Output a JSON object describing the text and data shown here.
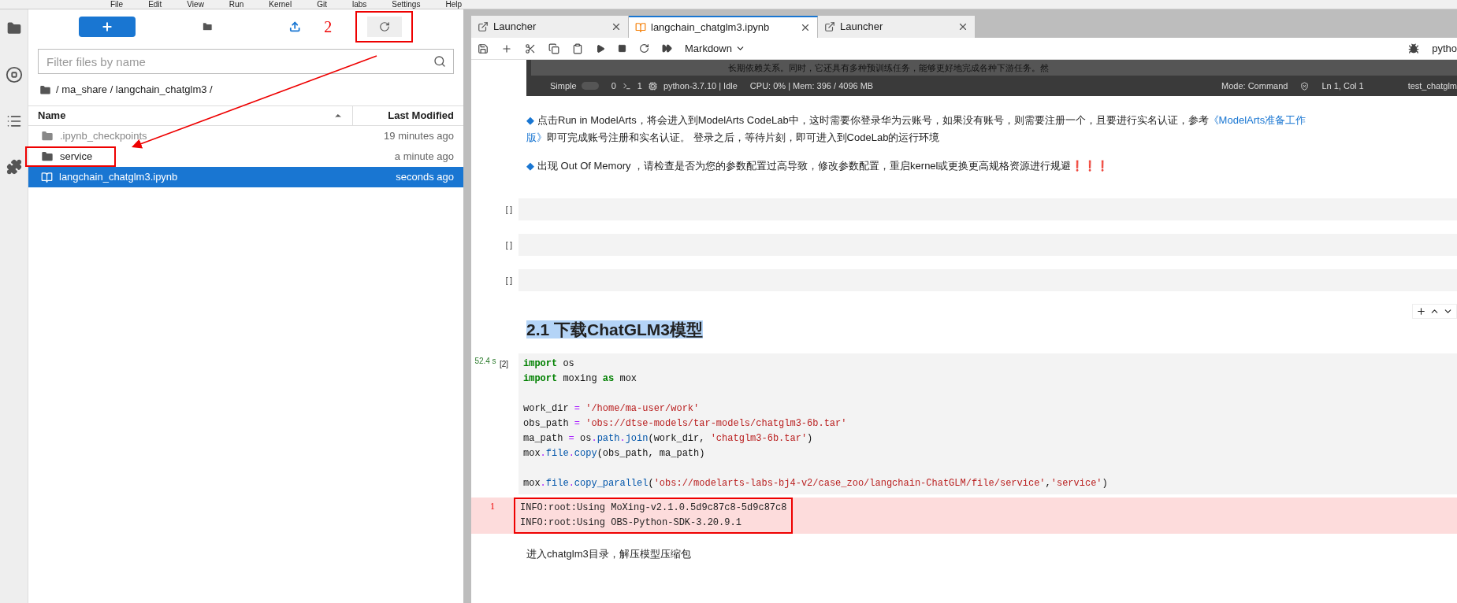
{
  "menu": [
    "File",
    "Edit",
    "View",
    "Run",
    "Kernel",
    "Git",
    "labs",
    "Settings",
    "Help"
  ],
  "file_browser": {
    "annotation": "2",
    "search": {
      "placeholder": "Filter files by name"
    },
    "breadcrumb": "/ ma_share / langchain_chatglm3 /",
    "columns": [
      "Name",
      "Last Modified"
    ],
    "rows": [
      {
        "kind": "folder",
        "name": ".ipynb_checkpoints",
        "modified": "19 minutes ago",
        "selected": false,
        "dim": true,
        "highlighted": false
      },
      {
        "kind": "folder",
        "name": "service",
        "modified": "a minute ago",
        "selected": false,
        "dim": false,
        "highlighted": true
      },
      {
        "kind": "notebook",
        "name": "langchain_chatglm3.ipynb",
        "modified": "seconds ago",
        "selected": true,
        "dim": false,
        "highlighted": false
      }
    ]
  },
  "tabs": [
    {
      "kind": "launcher",
      "label": "Launcher",
      "selected": false
    },
    {
      "kind": "notebook",
      "label": "langchain_chatglm3.ipynb",
      "selected": true
    },
    {
      "kind": "launcher",
      "label": "Launcher",
      "selected": false
    }
  ],
  "toolbar": {
    "cell_type": "Markdown",
    "kernel": "pytho"
  },
  "embedded_screenshot": {
    "text": "长期依赖关系。同时，它还具有多种预训练任务，能够更好地完成各种下游任务。然",
    "status": [
      "Simple",
      "0",
      "1",
      "python-3.7.10 | Idle",
      "CPU: 0% | Mem: 396 / 4096 MB",
      "Mode: Command",
      "Ln 1, Col 1",
      "test_chatglm"
    ]
  },
  "paragraphs": [
    {
      "bullet": "◆",
      "lines": [
        [
          {
            "text": "点击Run in ModelArts，将会进入到ModelArts CodeLab中，这时需要你登录华为云账号，如果没有账号，则需要注册一个，且要进行实名认证，参考"
          },
          {
            "link": "《ModelArts准备工作"
          }
        ],
        [
          {
            "link": "版》"
          },
          {
            "text": " 即可完成账号注册和实名认证。 登录之后，等待片刻，即可进入到CodeLab的运行环境"
          }
        ]
      ]
    },
    {
      "bullet": "◆",
      "lines": [
        [
          {
            "text": "出现 Out Of Memory ，请检查是否为您的参数配置过高导致，修改参数配置，重启kernel或更换更高规格资源进行规避❗❗❗"
          }
        ]
      ]
    }
  ],
  "empty_cells": [
    "[ ]",
    "[ ]",
    "[ ]"
  ],
  "heading": "2.1 下载ChatGLM3模型",
  "code_cell": {
    "time": "52.4 s",
    "prompt": "[2]",
    "lines": [
      {
        "gap_before": false,
        "tokens": [
          {
            "kind": "kw",
            "text": "import"
          },
          {
            "kind": "plain",
            "text": " os"
          }
        ]
      },
      {
        "gap_before": false,
        "tokens": [
          {
            "kind": "kw",
            "text": "import"
          },
          {
            "kind": "plain",
            "text": " moxing "
          },
          {
            "kind": "kw",
            "text": "as"
          },
          {
            "kind": "plain",
            "text": " mox"
          }
        ]
      },
      {
        "gap_before": true,
        "tokens": [
          {
            "kind": "plain",
            "text": "work_dir "
          },
          {
            "kind": "op",
            "text": "="
          },
          {
            "kind": "str",
            "text": " '/home/ma-user/work'"
          }
        ]
      },
      {
        "gap_before": false,
        "tokens": [
          {
            "kind": "plain",
            "text": "obs_path "
          },
          {
            "kind": "op",
            "text": "="
          },
          {
            "kind": "str",
            "text": " 'obs://dtse-models/tar-models/chatglm3-6b.tar'"
          }
        ]
      },
      {
        "gap_before": false,
        "tokens": [
          {
            "kind": "plain",
            "text": "ma_path "
          },
          {
            "kind": "op",
            "text": "="
          },
          {
            "kind": "plain",
            "text": " os"
          },
          {
            "kind": "op",
            "text": "."
          },
          {
            "kind": "fn",
            "text": "path"
          },
          {
            "kind": "op",
            "text": "."
          },
          {
            "kind": "fn",
            "text": "join"
          },
          {
            "kind": "plain",
            "text": "(work_dir, "
          },
          {
            "kind": "str",
            "text": "'chatglm3-6b.tar'"
          },
          {
            "kind": "plain",
            "text": ")"
          }
        ]
      },
      {
        "gap_before": false,
        "tokens": [
          {
            "kind": "plain",
            "text": "mox"
          },
          {
            "kind": "op",
            "text": "."
          },
          {
            "kind": "fn",
            "text": "file"
          },
          {
            "kind": "op",
            "text": "."
          },
          {
            "kind": "fn",
            "text": "copy"
          },
          {
            "kind": "plain",
            "text": "(obs_path, ma_path)"
          }
        ]
      },
      {
        "gap_before": true,
        "tokens": [
          {
            "kind": "plain",
            "text": "mox"
          },
          {
            "kind": "op",
            "text": "."
          },
          {
            "kind": "fn",
            "text": "file"
          },
          {
            "kind": "op",
            "text": "."
          },
          {
            "kind": "fn",
            "text": "copy_parallel"
          },
          {
            "kind": "plain",
            "text": "("
          },
          {
            "kind": "str",
            "text": "'obs://modelarts-labs-bj4-v2/case_zoo/langchain-ChatGLM/file/service'"
          },
          {
            "kind": "plain",
            "text": ","
          },
          {
            "kind": "str",
            "text": "'service'"
          },
          {
            "kind": "plain",
            "text": ")"
          }
        ]
      }
    ],
    "output_annotation": "1",
    "output": [
      "INFO:root:Using MoXing-v2.1.0.5d9c87c8-5d9c87c8",
      "INFO:root:Using OBS-Python-SDK-3.20.9.1"
    ]
  },
  "final_text": "进入chatglm3目录，解压模型压缩包"
}
